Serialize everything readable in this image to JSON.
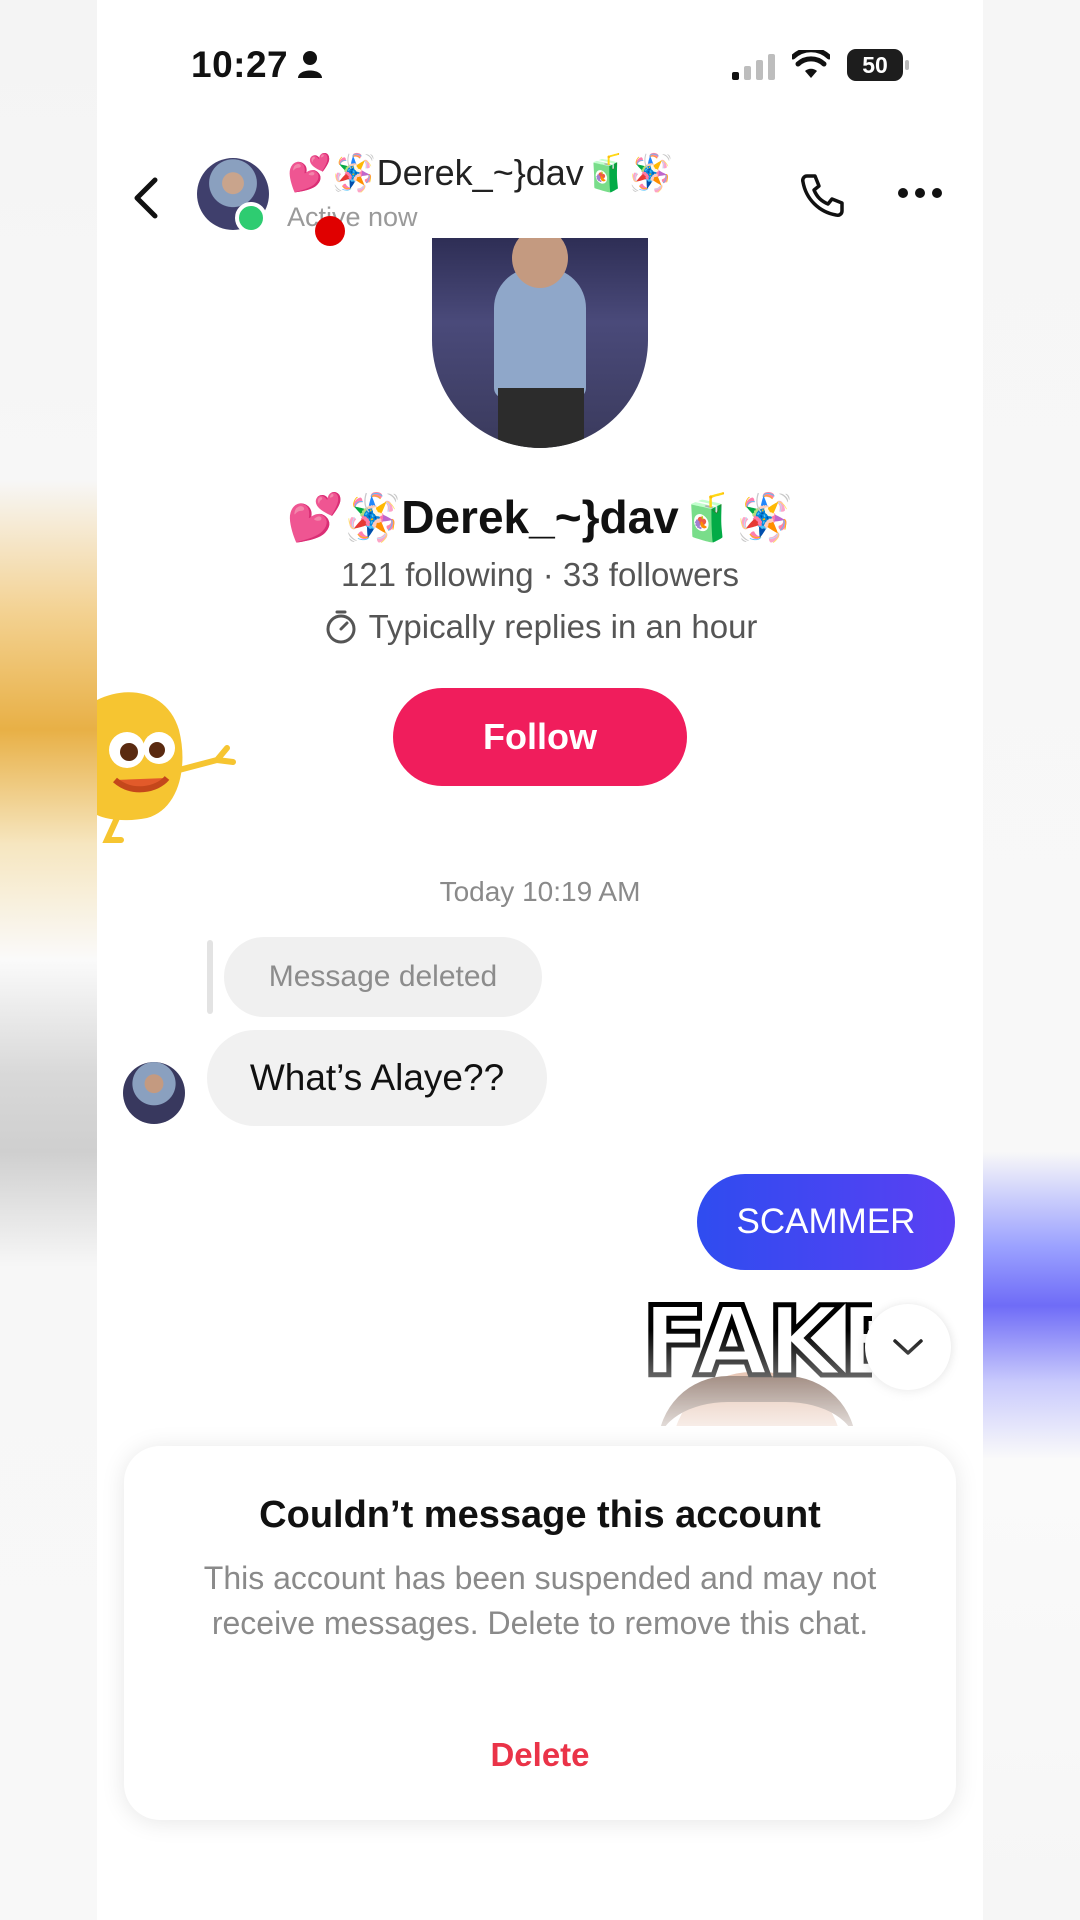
{
  "status_bar": {
    "time": "10:27",
    "battery": "50"
  },
  "header": {
    "name": "💕🪅Derek_~}dav🧃🪅",
    "status": "Active now"
  },
  "profile": {
    "name": "💕🪅Derek_~}dav🧃🪅",
    "stats": "121 following · 33 followers",
    "replies": "Typically replies in an hour",
    "follow_label": "Follow"
  },
  "chat": {
    "date": "Today 10:19 AM",
    "deleted_label": "Message deleted",
    "received_message": "What’s Alaye??",
    "sent_message": "SCAMMER",
    "sticker_text": "FAKE"
  },
  "notice": {
    "title": "Couldn’t message this account",
    "body": "This account has been suspended and may not receive messages. Delete to remove this chat.",
    "delete_label": "Delete"
  },
  "colors": {
    "follow": "#f01d5c",
    "sent_bubble": "#3d48f1",
    "delete": "#ea3348",
    "online": "#2ecc71"
  }
}
